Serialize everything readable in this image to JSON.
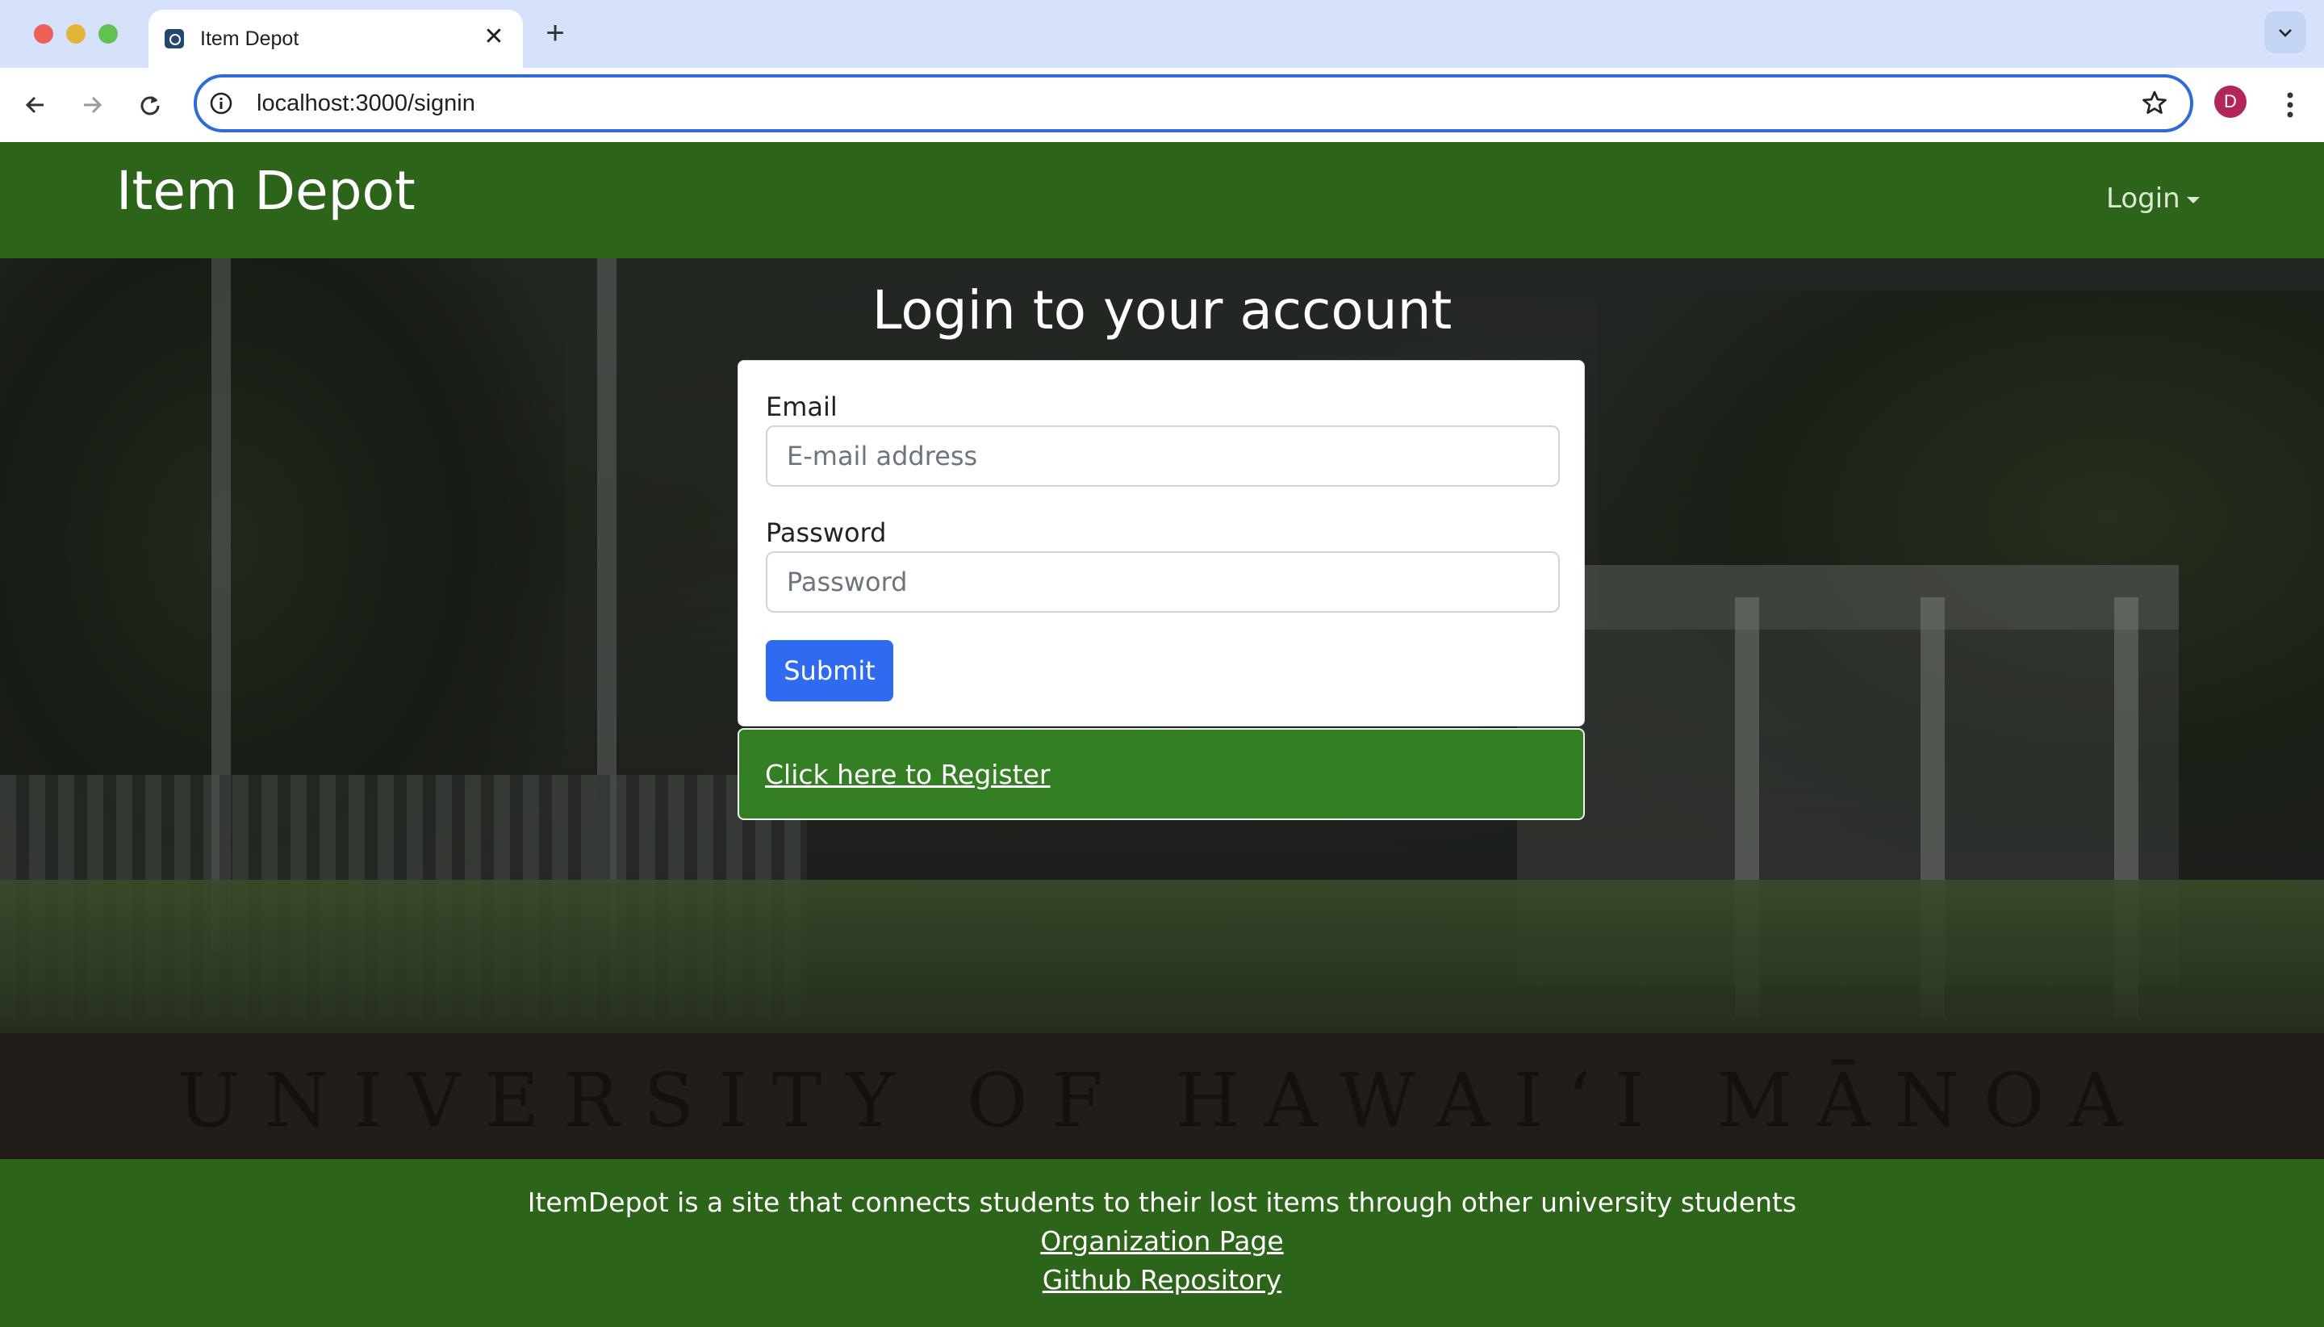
{
  "browser": {
    "tab_title": "Item Depot",
    "tab_close": "✕",
    "new_tab": "+",
    "url": "localhost:3000/signin",
    "profile_initial": "D",
    "accent_color": "#2d6bd9"
  },
  "navbar": {
    "brand": "Item Depot",
    "login_menu": "Login",
    "background_color": "#2c651a"
  },
  "signin": {
    "title": "Login to your account",
    "email_label": "Email",
    "email_placeholder": "E-mail address",
    "password_label": "Password",
    "password_placeholder": "Password",
    "submit_label": "Submit",
    "submit_color": "#2f6bf0",
    "register_link": "Click here to Register",
    "register_color": "#347f23"
  },
  "background": {
    "wall_text": "UNIVERSITY OF HAWAIʻI MĀNOA"
  },
  "footer": {
    "description": "ItemDepot is a site that connects students to their lost items through other university students",
    "organization_link": "Organization Page",
    "github_link": "Github Repository"
  }
}
